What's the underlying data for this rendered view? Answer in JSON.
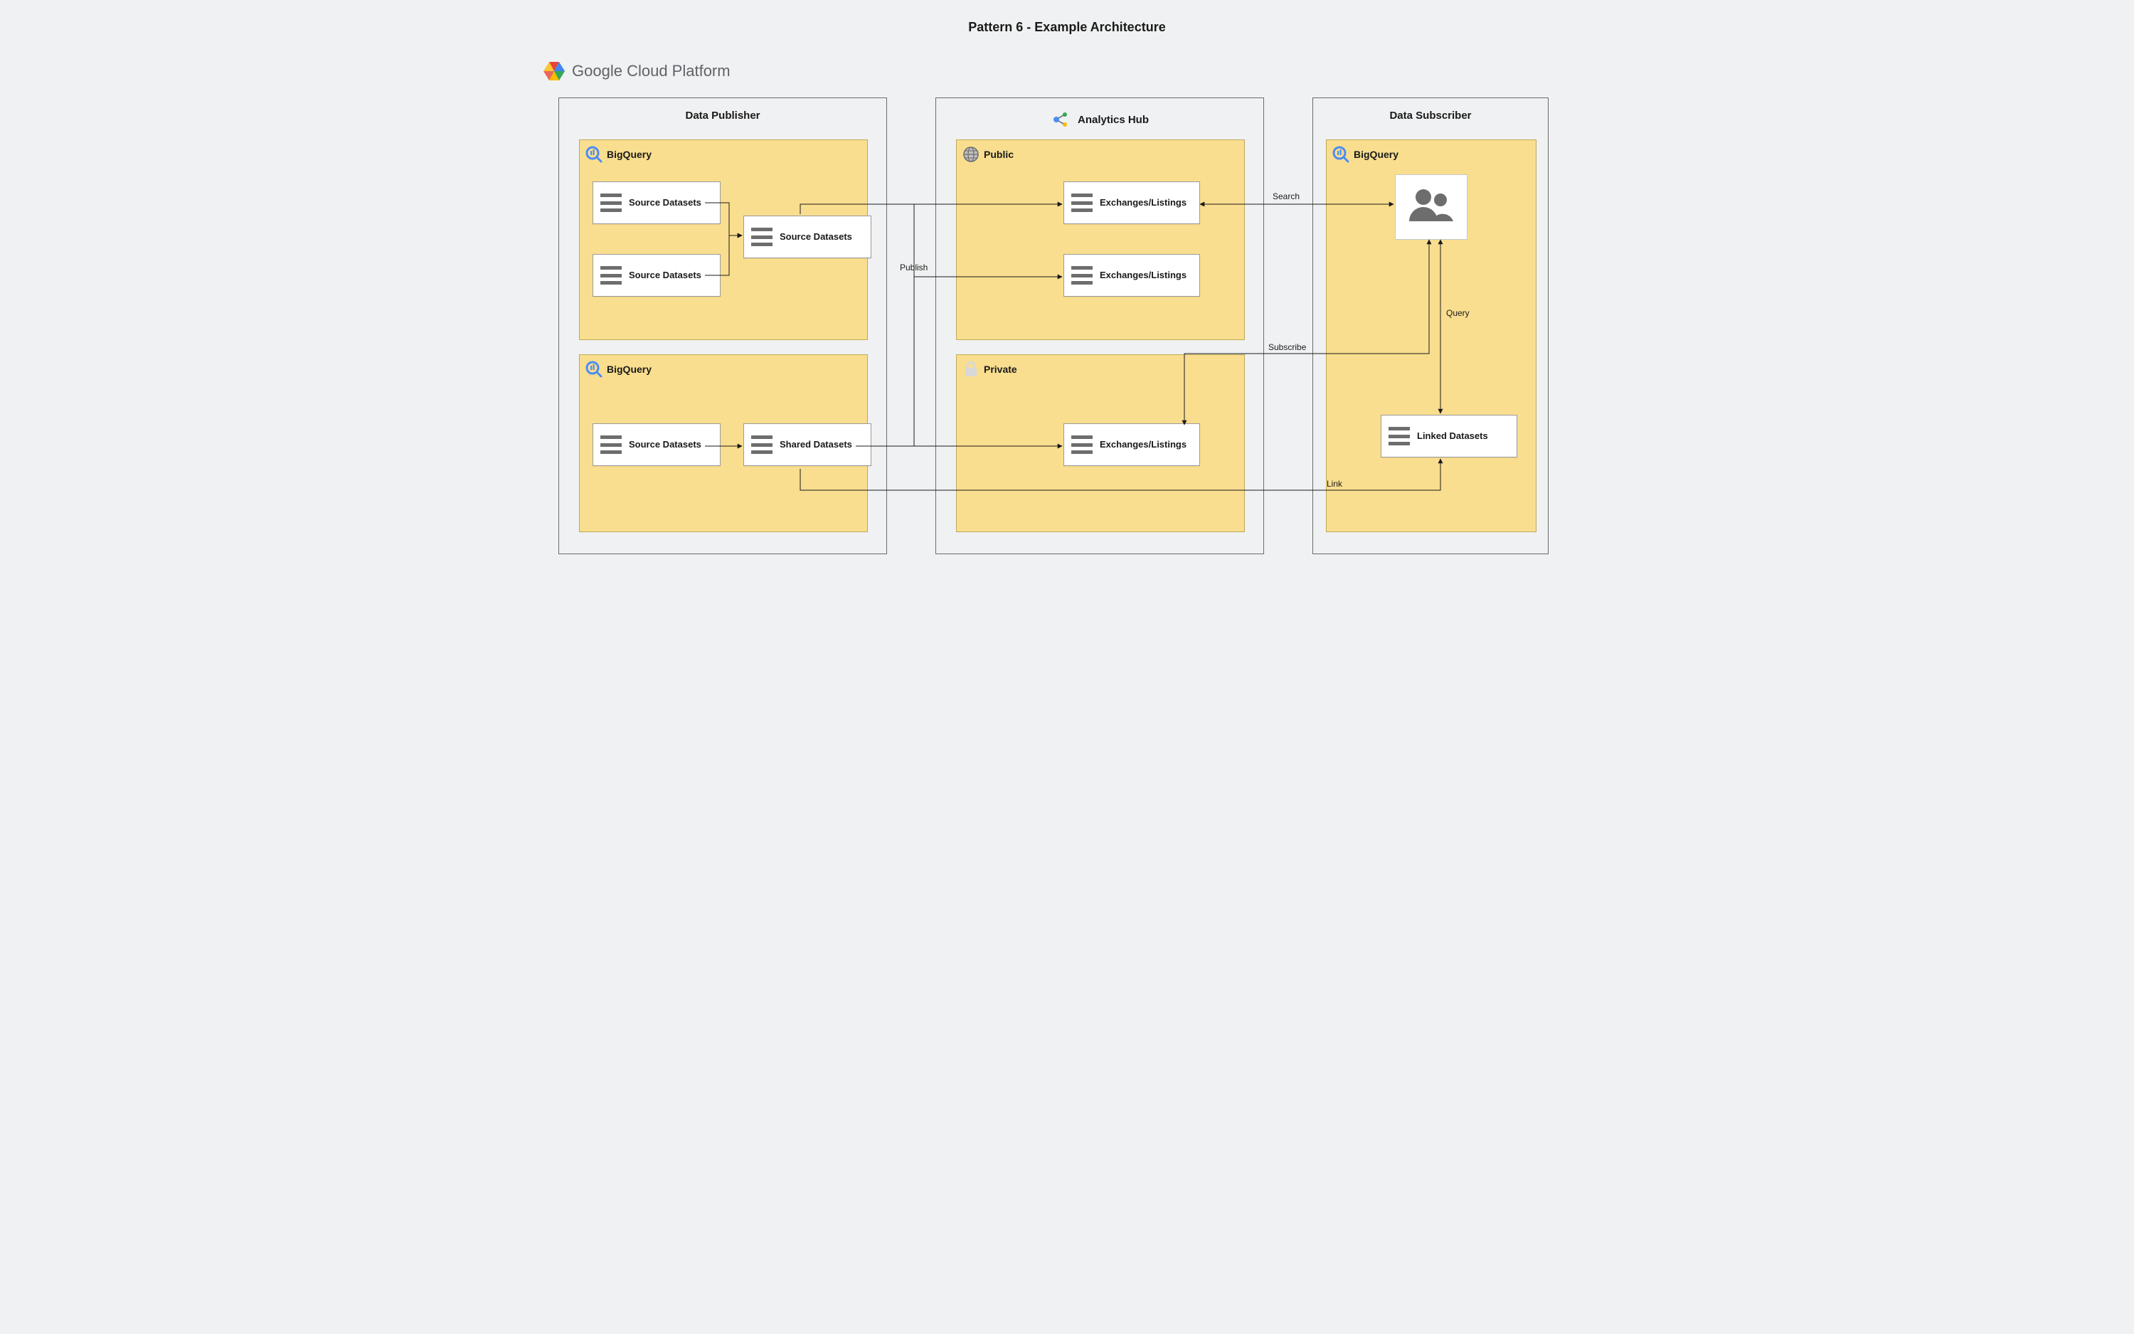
{
  "title": "Pattern 6 - Example Architecture",
  "brand": {
    "google": "Google",
    "rest": "Cloud Platform"
  },
  "columns": {
    "publisher": {
      "title": "Data Publisher"
    },
    "hub": {
      "title": "Analytics Hub"
    },
    "subscriber": {
      "title": "Data Subscriber"
    }
  },
  "cards": {
    "pub_bq1": {
      "label": "BigQuery"
    },
    "pub_bq2": {
      "label": "BigQuery"
    },
    "hub_pub": {
      "label": "Public"
    },
    "hub_priv": {
      "label": "Private"
    },
    "sub_bq": {
      "label": "BigQuery"
    }
  },
  "chips": {
    "src1": "Source Datasets",
    "src2": "Source Datasets",
    "src3": "Source Datasets",
    "src4": "Source Datasets",
    "shared": "Shared Datasets",
    "ex1": "Exchanges/Listings",
    "ex2": "Exchanges/Listings",
    "ex3": "Exchanges/Listings",
    "linked": "Linked Datasets"
  },
  "edges": {
    "publish": "Publish",
    "search": "Search",
    "subscribe": "Subscribe",
    "query": "Query",
    "link": "Link"
  },
  "icons": {
    "bigquery": "bigquery-icon",
    "analytics_hub": "analytics-hub-icon",
    "globe": "globe-icon",
    "lock": "lock-icon",
    "users": "users-icon",
    "dataset": "dataset-icon",
    "gcp": "gcp-hex-icon"
  },
  "colors": {
    "card_bg": "#f9de8f",
    "card_border": "#bfa85a",
    "outline": "#6b6b6b",
    "chip_border": "#9a9a9a"
  }
}
